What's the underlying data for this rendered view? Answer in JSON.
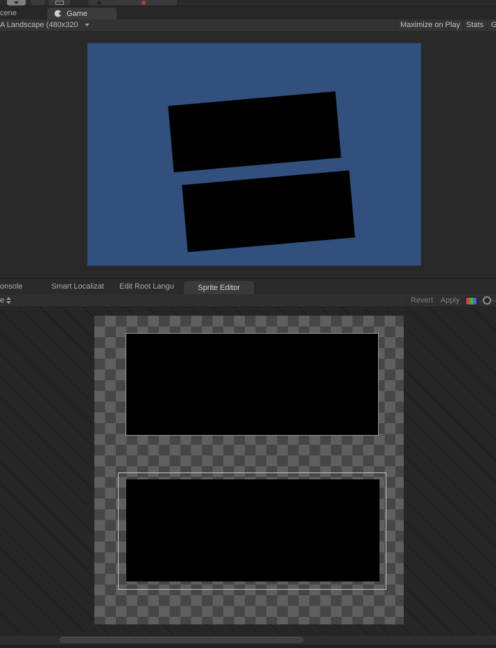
{
  "top_toolbar": {
    "tools": [
      {
        "name": "move-tool",
        "highlighted": true
      },
      {
        "name": "tool-2",
        "highlighted": false
      },
      {
        "name": "rect-tool",
        "highlighted": false
      }
    ],
    "play_controls": {
      "record_dot_color": "#c03a36"
    }
  },
  "game_panel": {
    "tabs": [
      {
        "label": "cene",
        "active": false
      },
      {
        "label": "Game",
        "active": true,
        "icon": "unity-pacman-icon"
      }
    ],
    "toolbar": {
      "aspect_label": "A Landscape (480x320",
      "buttons": [
        {
          "label": "Maximize on Play"
        },
        {
          "label": "Stats"
        },
        {
          "label": "G"
        }
      ]
    },
    "viewport": {
      "background_color": "#31507d",
      "sprite_color": "#000000",
      "sprite_rotation_deg": -5,
      "sprite_count": 2
    }
  },
  "sprite_editor_panel": {
    "tabs": [
      {
        "label": "onsole",
        "active": false
      },
      {
        "label": "Smart Localizat",
        "active": false
      },
      {
        "label": "Edit Root Langu",
        "active": false
      },
      {
        "label": "Sprite Editor",
        "active": true
      }
    ],
    "toolbar": {
      "left_dropdown_label": "e",
      "revert_label": "Revert",
      "apply_label": "Apply",
      "rgb_icon_colors": [
        "#c04848",
        "#46ad46",
        "#4668d0"
      ]
    },
    "canvas": {
      "checker_light": "#5f5f5f",
      "checker_dark": "#464646",
      "sprite_fill": "#000000",
      "sprite_1_outline": "#9c9c9c",
      "sprite_2_selection_outline": "#c6c6c6"
    }
  }
}
